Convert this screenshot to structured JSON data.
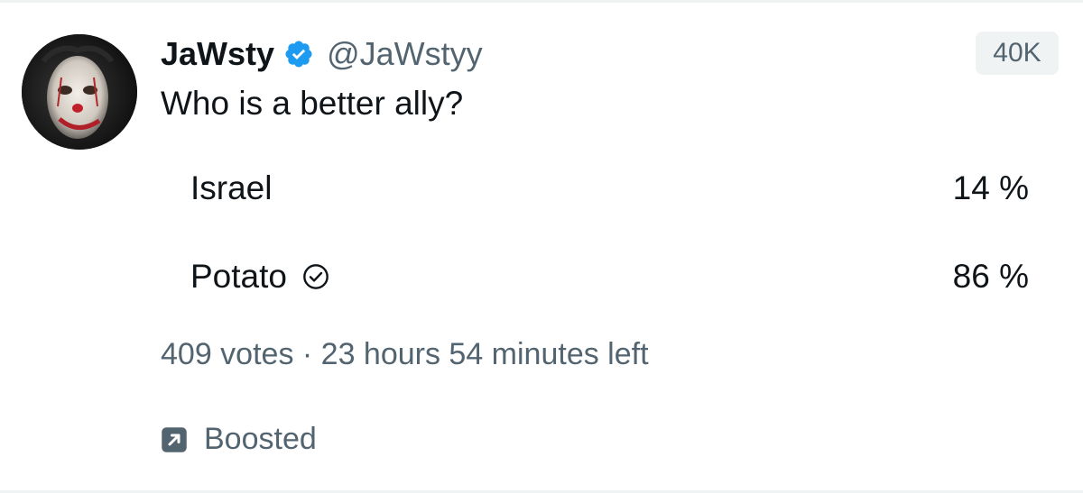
{
  "tweet": {
    "author": {
      "display_name": "JaWsty",
      "handle": "@JaWstyy",
      "verified": true,
      "avatar": "clown-face-avatar"
    },
    "views": "40K",
    "text": "Who is a better ally?"
  },
  "poll": {
    "options": [
      {
        "label": "Israel",
        "percent_text": "14 %",
        "percent": 14,
        "selected": false
      },
      {
        "label": "Potato",
        "percent_text": "86 %",
        "percent": 86,
        "selected": true,
        "icon": "check-circle-icon"
      }
    ],
    "meta": "409 votes · 23 hours 54 minutes left"
  },
  "boost": {
    "label": "Boosted",
    "icon": "boosted-arrow-icon"
  },
  "colors": {
    "verified_blue": "#1d9bf0",
    "text_primary": "#0f1419",
    "text_secondary": "#536471",
    "chip_bg": "#eff3f4"
  }
}
